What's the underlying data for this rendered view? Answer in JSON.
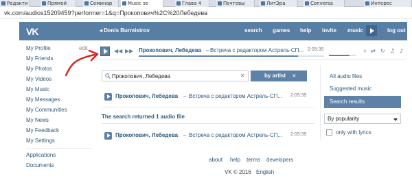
{
  "browser": {
    "tabs": [
      {
        "label": "Редакти",
        "active": false
      },
      {
        "label": "Прямой",
        "active": false
      },
      {
        "label": "Семинар",
        "active": false
      },
      {
        "label": "Music se",
        "active": true
      },
      {
        "label": "Глава 4",
        "active": false
      },
      {
        "label": "Почтовы",
        "active": false
      },
      {
        "label": "ЛитЭра",
        "active": false
      },
      {
        "label": "Conversa",
        "active": false
      },
      {
        "label": "Интерес",
        "active": false
      }
    ],
    "url": "vk.com/audios15209459?performer=1&q=Прокопович%2C%20Лебедева"
  },
  "header": {
    "logo": "VK",
    "user_name": "Denis Burmistrov",
    "nav": [
      "search",
      "games",
      "help",
      "invite",
      "music",
      "log out"
    ],
    "accent": "#587ea3"
  },
  "sidebar": {
    "edit_label": "edit",
    "items": [
      "My Profile",
      "My Friends",
      "My Photos",
      "My Videos",
      "My Music",
      "My Messages",
      "My Communities",
      "My News",
      "My Feedback",
      "My Settings"
    ],
    "secondary_items": [
      "Applications",
      "Documents"
    ]
  },
  "player": {
    "artist": "Прокопович, Лебедева",
    "separator": "–",
    "title": "Встреча с редактором Астрель-СП...",
    "time": "2:05:39",
    "progress": 0.86,
    "volume": 0.75,
    "control_icons": [
      "prev-icon",
      "next-icon",
      "add-icon",
      "shuffle-icon",
      "repeat-icon",
      "broadcast-icon",
      "status-icon"
    ]
  },
  "search": {
    "value": "Прокопович, Лебедева",
    "filter_label": "by artist",
    "clear_glyph": "×"
  },
  "results": {
    "top_row": {
      "artist": "Прокопович, Лебедева",
      "separator": "–",
      "title": "Встреча с редактором Астрель-СП...",
      "time": "2:05:39"
    },
    "message": "The search returned 1 audio file",
    "rows": [
      {
        "artist": "Прокопович, Лебедева",
        "separator": "–",
        "title": "Встреча с редактором Астрель-СП...",
        "time": "2:05:39"
      }
    ]
  },
  "right_panel": {
    "links": [
      "All audio files",
      "Suggested music"
    ],
    "selected": "Search results",
    "sort_value": "By popularity",
    "checkbox_label": "only with lyrics",
    "checkbox_checked": false
  },
  "footer": {
    "links": [
      "about",
      "help",
      "terms",
      "developers"
    ],
    "copyright": "VK © 2016",
    "language": "English"
  },
  "annotation": {
    "color": "#d9241c"
  }
}
